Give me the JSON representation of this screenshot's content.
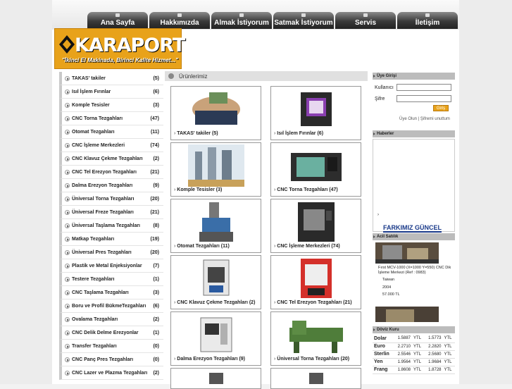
{
  "nav": {
    "items": [
      "Ana Sayfa",
      "Hakkımızda",
      "Almak İstiyorum",
      "Satmak İstiyorum",
      "Servis",
      "İletişim"
    ]
  },
  "logo": {
    "name": "KARAPORT",
    "slogan": "\"İkinci El Makinada, Birinci Kalite Hizmet...\""
  },
  "categories": [
    {
      "name": "TAKAS' takiler",
      "count": "(5)"
    },
    {
      "name": "Isıl İşlem Fırınlar",
      "count": "(6)"
    },
    {
      "name": "Komple Tesisler",
      "count": "(3)"
    },
    {
      "name": "CNC Torna Tezgahları",
      "count": "(47)"
    },
    {
      "name": "Otomat Tezgahları",
      "count": "(11)"
    },
    {
      "name": "CNC İşleme Merkezleri",
      "count": "(74)"
    },
    {
      "name": "CNC Klavuz Çekme Tezgahları",
      "count": "(2)"
    },
    {
      "name": "CNC Tel Erezyon Tezgahları",
      "count": "(21)"
    },
    {
      "name": "Dalma Erezyon Tezgahları",
      "count": "(9)"
    },
    {
      "name": "Üniversal Torna Tezgahları",
      "count": "(20)"
    },
    {
      "name": "Üniversal Freze Tezgahları",
      "count": "(21)"
    },
    {
      "name": "Üniversal Taşlama Tezgahları",
      "count": "(8)"
    },
    {
      "name": "Matkap Tezgahları",
      "count": "(19)"
    },
    {
      "name": "Üniversal Pres Tezgahları",
      "count": "(20)"
    },
    {
      "name": "Plastik ve Metal Enjeksiyonlar",
      "count": "(7)"
    },
    {
      "name": "Testere Tezgahları",
      "count": "(1)"
    },
    {
      "name": "CNC Taşlama Tezgahları",
      "count": "(3)"
    },
    {
      "name": "Boru ve Profil BükmeTezgahları",
      "count": "(6)"
    },
    {
      "name": "Ovalama Tezgahları",
      "count": "(2)"
    },
    {
      "name": "CNC Delik Delme Erezyonlar",
      "count": "(1)"
    },
    {
      "name": "Transfer Tezgahları",
      "count": "(0)"
    },
    {
      "name": "CNC Panç Pres Tezgahları",
      "count": "(0)"
    },
    {
      "name": "CNC Lazer ve Plazma Tezgahları",
      "count": "(2)"
    }
  ],
  "products_header": "Ürünlerimiz",
  "products": [
    "TAKAS' takiler (5)",
    "Isıl İşlem Fırınlar (6)",
    "Komple Tesisler (3)",
    "CNC Torna Tezgahları (47)",
    "Otomat Tezgahları (11)",
    "CNC İşleme Merkezleri (74)",
    "CNC Klavuz Çekme Tezgahları (2)",
    "CNC Tel Erezyon Tezgahları (21)",
    "Dalma Erezyon Tezgahları (9)",
    "Üniversal Torna Tezgahları (20)"
  ],
  "login": {
    "title": "Üye Girişi",
    "user_label": "Kullanıcı",
    "pass_label": "Şifre",
    "button": "Giriş",
    "links": "Üye Olun | Şifremi unuttum"
  },
  "news": {
    "title": "Haberler",
    "banner": "FARKIMIZ GÜNCEL"
  },
  "urgent": {
    "title": "Acil Satılık",
    "item_title": "Fırst MCV-1000 (X=1000 Y=550) CNC Dik İşleme Merkezi (Ref : 0983)",
    "origin": "Taiwan",
    "year": "2004",
    "price": "57.000 TL"
  },
  "currency": {
    "title": "Döviz Kuru",
    "rows": [
      {
        "name": "Dolar",
        "buy": "1.5887",
        "u1": "YTL",
        "sell": "1.5773",
        "u2": "YTL"
      },
      {
        "name": "Euro",
        "buy": "2.2710",
        "u1": "YTL",
        "sell": "2.2820",
        "u2": "YTL"
      },
      {
        "name": "Sterlin",
        "buy": "2.5546",
        "u1": "YTL",
        "sell": "2.5680",
        "u2": "YTL"
      },
      {
        "name": "Yen",
        "buy": "1.9564",
        "u1": "YTL",
        "sell": "1.9684",
        "u2": "YTL"
      },
      {
        "name": "Frang",
        "buy": "1.8608",
        "u1": "YTL",
        "sell": "1.8728",
        "u2": "YTL"
      }
    ]
  }
}
